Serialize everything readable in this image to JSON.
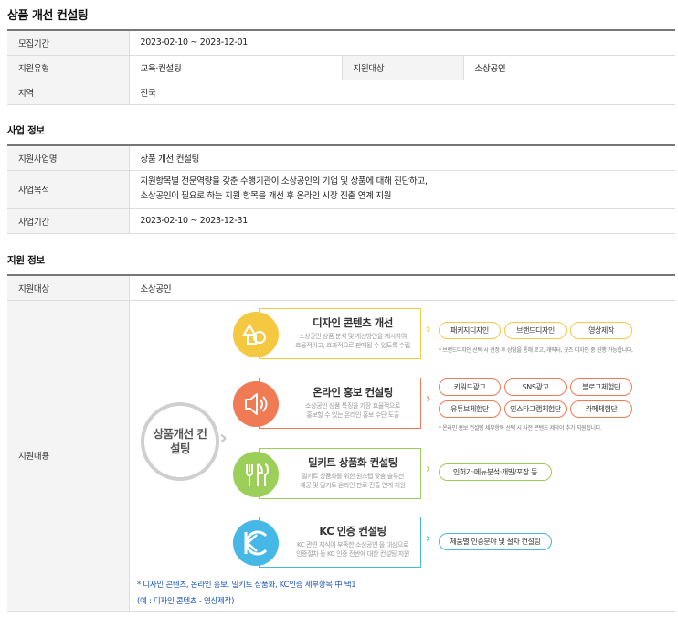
{
  "page_title": "상품 개선 컨설팅",
  "recruit": {
    "period_label": "모집기간",
    "period_value": "2023-02-10 ~ 2023-12-01",
    "type_label": "지원유형",
    "type_value": "교육·컨설팅",
    "target_label": "지원대상",
    "target_value": "소상공인",
    "region_label": "지역",
    "region_value": "전국"
  },
  "business": {
    "section_title": "사업 정보",
    "name_label": "지원사업명",
    "name_value": "상품 개선 컨설팅",
    "purpose_label": "사업목적",
    "purpose_line1": "지원항목별 전문역량을 갖춘 수행기관이 소상공인의 기업 및 상품에 대해 진단하고,",
    "purpose_line2": "소상공인이 필요로 하는 지원 항목을 개선 후 온라인 시장 진출 연계 지원",
    "period_label": "사업기간",
    "period_value": "2023-02-10 ~ 2023-12-31"
  },
  "support": {
    "section_title": "지원 정보",
    "target_label": "지원대상",
    "target_value": "소상공인",
    "content_label": "지원내용",
    "center_label": "상품개선 컨설팅",
    "cards": [
      {
        "title": "디자인 콘텐츠 개선",
        "desc1": "소상공인 상품 분석 및 개선방안을 제시하여",
        "desc2": "효율적이고, 효과적으로 판매될 수 있도록 수립",
        "color": "#f5c842",
        "icon": "shapes-icon",
        "pills": [
          "패키지디자인",
          "브랜드디자인",
          "영상제작"
        ],
        "note": "* 브랜드디자인 선택 시 선정 후 상담을 통해 로고, 캐릭터, 굿즈 디자인 중 진행 가능합니다."
      },
      {
        "title": "온라인 홍보 컨설팅",
        "desc1": "소상공인 상품 특징을 가장 효율적으로",
        "desc2": "홍보할 수 있는 온라인 홍보 수단 도출",
        "color": "#f07a54",
        "icon": "speaker-icon",
        "pills": [
          "키워드광고",
          "SNS광고",
          "블로그체험단",
          "유튜브체험단",
          "인스타그램체험단",
          "카페체험단"
        ],
        "note": "* 온라인 홍보 컨설팅 세부항목 선택 시 사전 콘텐츠 제작이 추가 지원됩니다."
      },
      {
        "title": "밀키트 상품화 컨설팅",
        "desc1": "밀키트 상품화를 위한 원스텝 맞춤 솔루션",
        "desc2": "제공 및 밀키트 온라인 판로 진출 연계 지원",
        "color": "#9bcf5a",
        "icon": "utensils-icon",
        "pills": [
          "인허가·메뉴분석·개발/포장 등"
        ]
      },
      {
        "title": "KC 인증 컨설팅",
        "desc1": "KC 관련 지식이 부족한 소상공인 을 대상으로",
        "desc2": "인증절차 등 KC 인증 전반에 대한 컨설팅 지원",
        "color": "#45b8e6",
        "icon": "kc-mark-icon",
        "pills": [
          "제품별 인증분야 및 절차 컨설팅"
        ]
      }
    ],
    "bottom_note1": "* 디자인 콘텐츠, 온라인 홍보, 밀키트 상품화, KC인증 세부항목 中 택1",
    "bottom_note2": "(예 : 디자인 콘텐츠 - 영상제작)"
  }
}
